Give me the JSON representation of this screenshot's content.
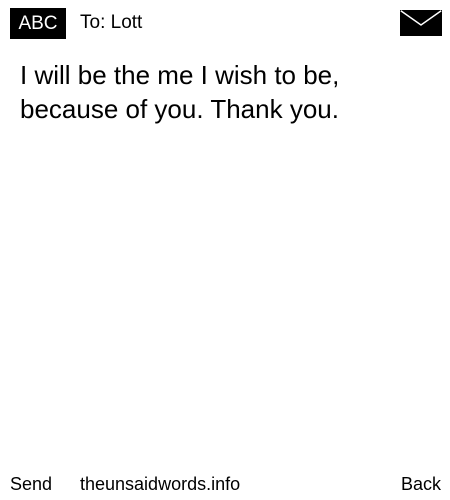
{
  "header": {
    "mode_label": "ABC",
    "to_label": "To: Lott",
    "icon": "envelope-icon"
  },
  "message": {
    "lines": [
      "I will be the me I wish to be,",
      "because of you. Thank you."
    ]
  },
  "footer": {
    "send_label": "Send",
    "site_label": "theunsaidwords.info",
    "back_label": "Back"
  },
  "colors": {
    "background": "#ffffff",
    "text": "#000000",
    "badge_background": "#000000",
    "badge_text": "#ffffff"
  }
}
